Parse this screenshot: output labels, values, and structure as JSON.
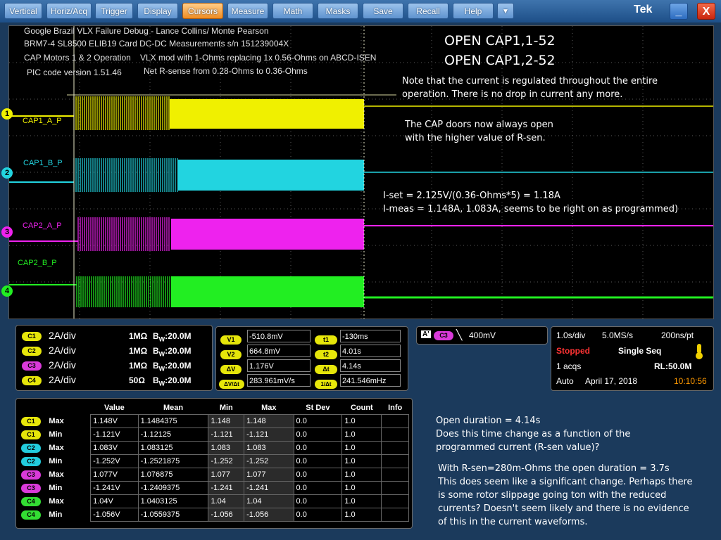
{
  "menu": {
    "items": [
      "Vertical",
      "Horiz/Acq",
      "Trigger",
      "Display",
      "Cursors",
      "Measure",
      "Math",
      "Masks",
      "Save",
      "Recall",
      "Help"
    ],
    "active": "Cursors",
    "dropdown": "▼",
    "brand": "Tek",
    "minimize": "_",
    "close": "X"
  },
  "screen": {
    "header": {
      "line1": "Google Brazil VLX Failure Debug - Lance Collins/ Monte Pearson",
      "line2": "BRM7-4 SL8500 ELIB19 Card DC-DC Measurements s/n 151239004X",
      "line3": "CAP Motors 1 & 2 Operation",
      "line3b": "VLX mod with 1-Ohms replacing 1x 0.56-Ohms on ABCD-ISEN",
      "line4": "PIC code version 1.51.46",
      "line4b": "Net R-sense from 0.28-Ohms to 0.36-Ohms"
    },
    "open1": "OPEN CAP1,1-52",
    "open2": "OPEN CAP1,2-52",
    "note1a": "Note that the current is regulated throughout the entire",
    "note1b": "operation. There is no drop in current any more.",
    "note2a": "The CAP doors now always open",
    "note2b": "with the higher value of R-sen.",
    "note3a": "I-set = 2.125V/(0.36-Ohms*5) = 1.18A",
    "note3b": "I-meas = 1.148A, 1.083A, seems to be right on as programmed)",
    "channels": [
      {
        "marker": "1",
        "label": "CAP1_A_P",
        "color": "#f0f000"
      },
      {
        "marker": "2",
        "label": "CAP1_B_P",
        "color": "#22d4e0"
      },
      {
        "marker": "3",
        "label": "CAP2_A_P",
        "color": "#ee22ee"
      },
      {
        "marker": "4",
        "label": "CAP2_B_P",
        "color": "#22ee22"
      }
    ]
  },
  "vertical": {
    "rows": [
      {
        "ch": "C1",
        "scale": "2A/div",
        "imp": "1MΩ",
        "bw_b": "B",
        "bw_w": "W",
        "bw": ":20.0M",
        "color": "#e6e60a"
      },
      {
        "ch": "C2",
        "scale": "2A/div",
        "imp": "1MΩ",
        "bw_b": "B",
        "bw_w": "W",
        "bw": ":20.0M",
        "color": "#e6e60a"
      },
      {
        "ch": "C3",
        "scale": "2A/div",
        "imp": "1MΩ",
        "bw_b": "B",
        "bw_w": "W",
        "bw": ":20.0M",
        "color": "#d93ad9"
      },
      {
        "ch": "C4",
        "scale": "2A/div",
        "imp": "50Ω",
        "bw_b": "B",
        "bw_w": "W",
        "bw": ":20.0M",
        "color": "#e6e60a"
      }
    ]
  },
  "cursors": {
    "v1_label": "V1",
    "v1": "-510.8mV",
    "v2_label": "V2",
    "v2": "664.8mV",
    "dv_label": "ΔV",
    "dv": "1.176V",
    "dvdt_label": "ΔV/Δt",
    "dvdt": "283.961mV/s",
    "t1_label": "t1",
    "t1": "-130ms",
    "t2_label": "t2",
    "t2": "4.01s",
    "dt_label": "Δt",
    "dt": "4.14s",
    "inv_label": "1/Δt",
    "inv": "241.546mHz"
  },
  "trigger": {
    "a": "A'",
    "ch": "C3",
    "level": "400mV"
  },
  "acq": {
    "timediv": "1.0s/div",
    "rate": "5.0MS/s",
    "pt": "200ns/pt",
    "status": "Stopped",
    "mode": "Single Seq",
    "acqs": "1 acqs",
    "rl": "RL:50.0M",
    "auto": "Auto",
    "date": "April 17, 2018",
    "time": "10:10:56"
  },
  "measurements": {
    "headers": [
      "",
      "",
      "Value",
      "Mean",
      "Min",
      "Max",
      "St Dev",
      "Count",
      "Info"
    ],
    "rows": [
      {
        "ch": "C1",
        "type": "Max",
        "value": "1.148V",
        "mean": "1.1484375",
        "min": "1.148",
        "max": "1.148",
        "std": "0.0",
        "count": "1.0",
        "color": "#e6e60a"
      },
      {
        "ch": "C1",
        "type": "Min",
        "value": "-1.121V",
        "mean": "-1.12125",
        "min": "-1.121",
        "max": "-1.121",
        "std": "0.0",
        "count": "1.0",
        "color": "#e6e60a"
      },
      {
        "ch": "C2",
        "type": "Max",
        "value": "1.083V",
        "mean": "1.083125",
        "min": "1.083",
        "max": "1.083",
        "std": "0.0",
        "count": "1.0",
        "color": "#22ccdd"
      },
      {
        "ch": "C2",
        "type": "Min",
        "value": "-1.252V",
        "mean": "-1.2521875",
        "min": "-1.252",
        "max": "-1.252",
        "std": "0.0",
        "count": "1.0",
        "color": "#22ccdd"
      },
      {
        "ch": "C3",
        "type": "Max",
        "value": "1.077V",
        "mean": "1.076875",
        "min": "1.077",
        "max": "1.077",
        "std": "0.0",
        "count": "1.0",
        "color": "#d93ad9"
      },
      {
        "ch": "C3",
        "type": "Min",
        "value": "-1.241V",
        "mean": "-1.2409375",
        "min": "-1.241",
        "max": "-1.241",
        "std": "0.0",
        "count": "1.0",
        "color": "#d93ad9"
      },
      {
        "ch": "C4",
        "type": "Max",
        "value": "1.04V",
        "mean": "1.0403125",
        "min": "1.04",
        "max": "1.04",
        "std": "0.0",
        "count": "1.0",
        "color": "#33dd33"
      },
      {
        "ch": "C4",
        "type": "Min",
        "value": "-1.056V",
        "mean": "-1.0559375",
        "min": "-1.056",
        "max": "-1.056",
        "std": "0.0",
        "count": "1.0",
        "color": "#33dd33"
      }
    ]
  },
  "notes": {
    "l1": "Open duration = 4.14s",
    "l2": "Does this time change as a function of the",
    "l3": "programmed current (R-sen value)?",
    "l4": "With R-sen=280m-Ohms the open duration = 3.7s",
    "l5": "This does seem like a significant change. Perhaps there",
    "l6": "is some rotor slippage going ton with the reduced",
    "l7": "currents? Doesn't seem likely and there is no evidence",
    "l8": "of this in the current waveforms."
  }
}
